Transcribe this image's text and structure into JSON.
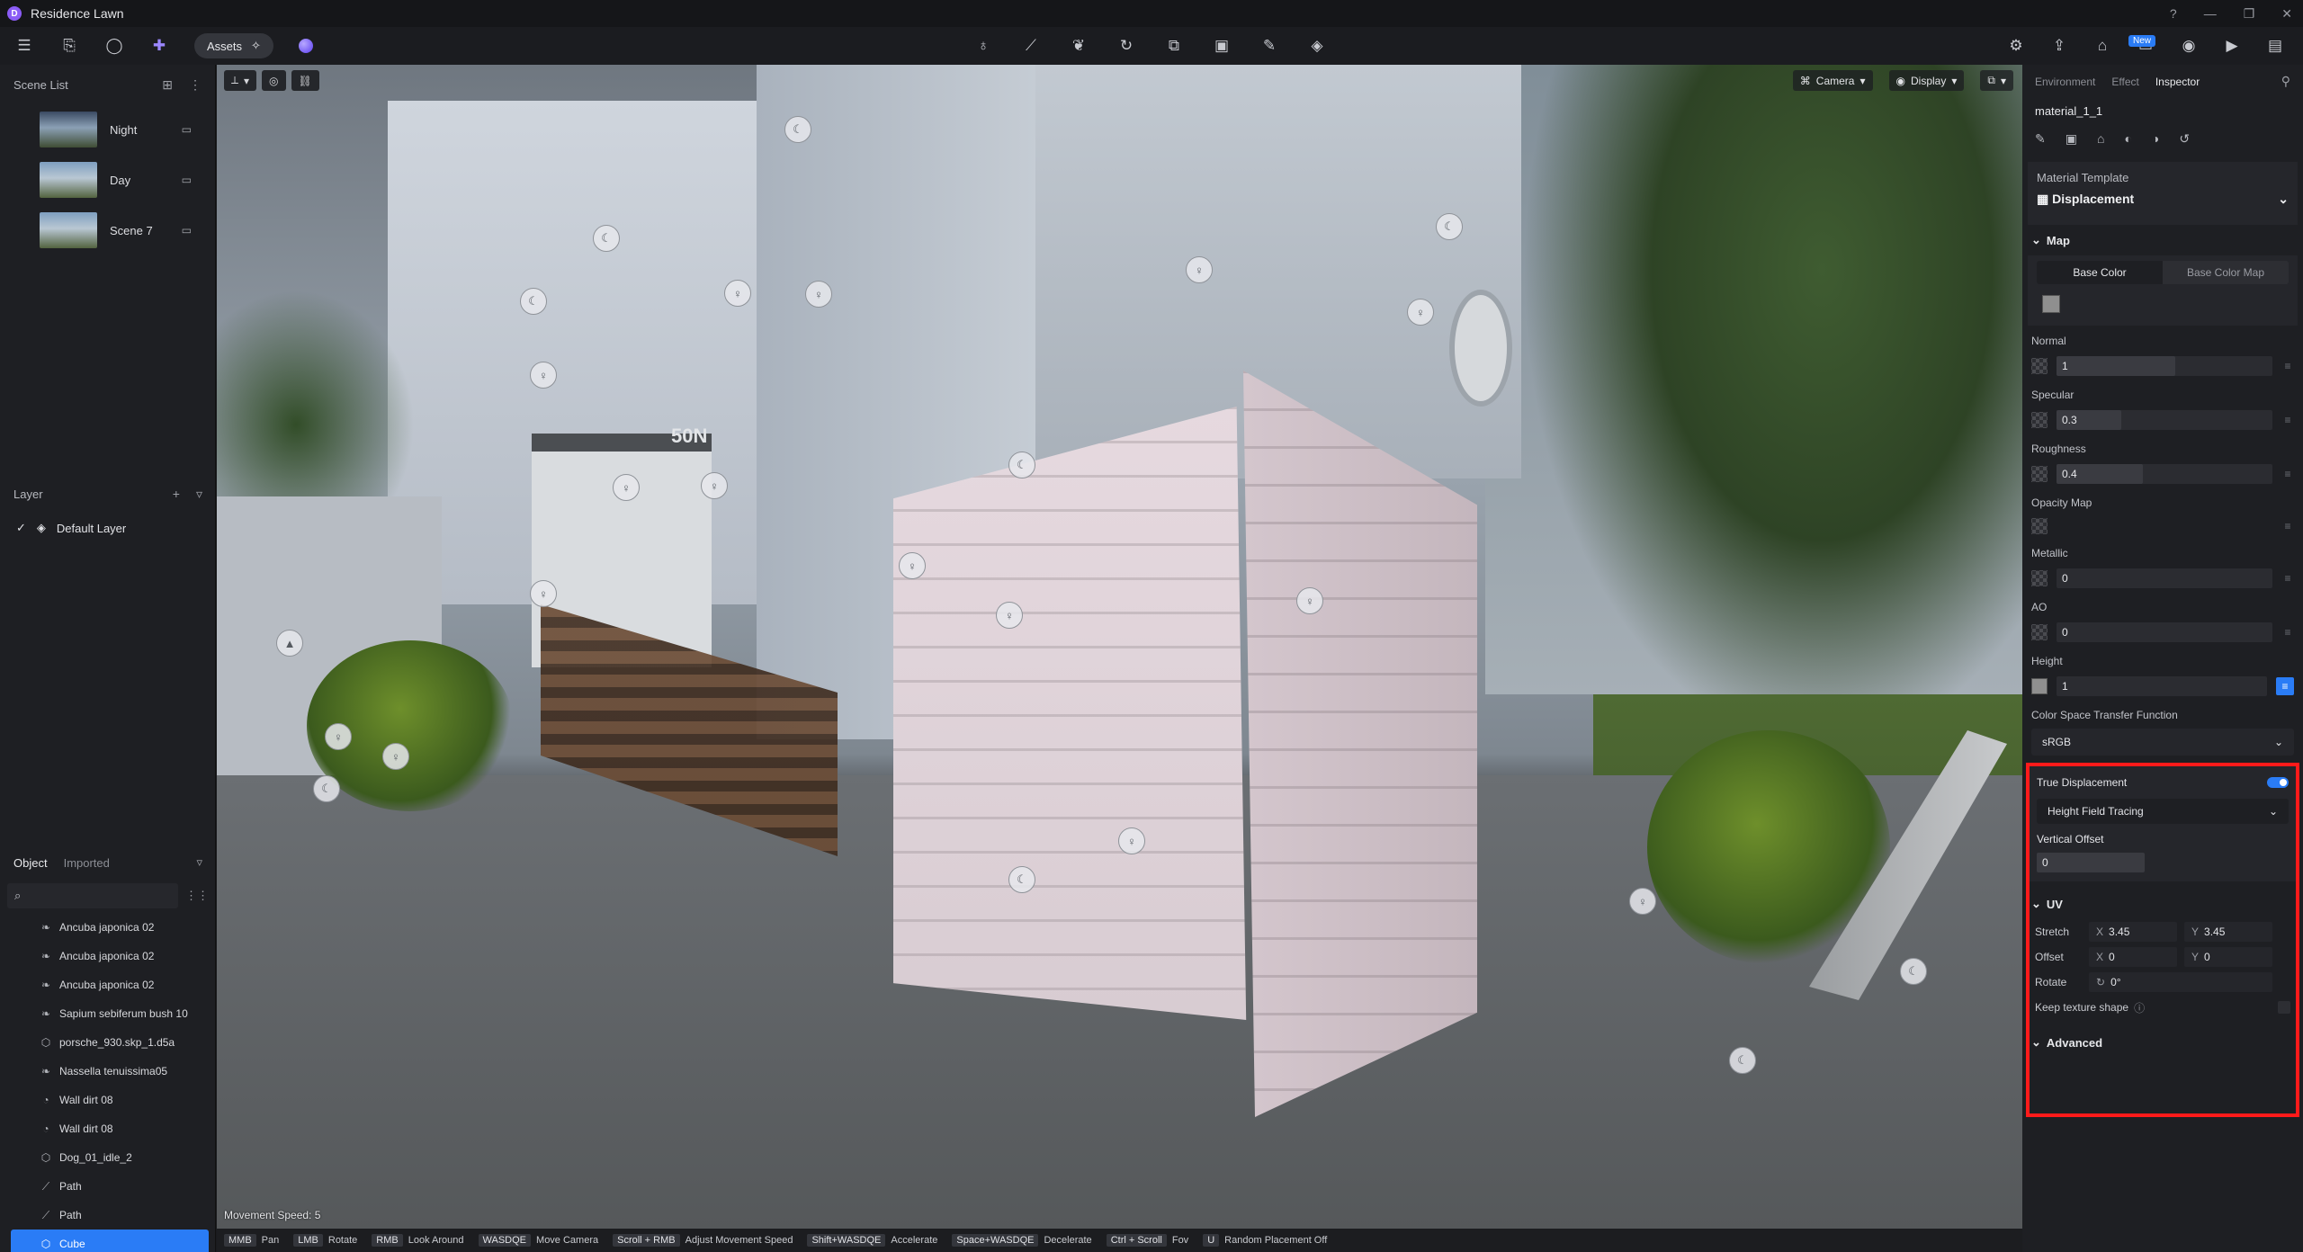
{
  "app": {
    "title": "Residence Lawn",
    "logo_letter": "D"
  },
  "window_controls": [
    "?",
    "—",
    "❐",
    "✕"
  ],
  "toolbar": {
    "assets_label": "Assets",
    "new_badge": "New"
  },
  "scene_list": {
    "title": "Scene List",
    "items": [
      {
        "name": "Night"
      },
      {
        "name": "Day"
      },
      {
        "name": "Scene 7"
      }
    ]
  },
  "layer": {
    "title": "Layer",
    "items": [
      {
        "name": "Default Layer"
      }
    ]
  },
  "objects": {
    "tab_object": "Object",
    "tab_imported": "Imported",
    "items": [
      {
        "name": "Ancuba japonica 02",
        "icon": "leaf-icon"
      },
      {
        "name": "Ancuba japonica 02",
        "icon": "leaf-icon"
      },
      {
        "name": "Ancuba japonica 02",
        "icon": "leaf-icon"
      },
      {
        "name": "Sapium sebiferum bush 10",
        "icon": "leaf-icon"
      },
      {
        "name": "porsche_930.skp_1.d5a",
        "icon": "model-icon"
      },
      {
        "name": "Nassella tenuissima05",
        "icon": "leaf-icon"
      },
      {
        "name": "Wall dirt 08",
        "icon": "decal-icon"
      },
      {
        "name": "Wall dirt 08",
        "icon": "decal-icon"
      },
      {
        "name": "Dog_01_idle_2",
        "icon": "model-icon"
      },
      {
        "name": "Path",
        "icon": "path-icon"
      },
      {
        "name": "Path",
        "icon": "path-icon"
      },
      {
        "name": "Cube",
        "icon": "model-icon",
        "selected": true
      }
    ]
  },
  "viewport": {
    "sign_text": "50N",
    "camera_label": "Camera",
    "display_label": "Display",
    "movement_speed": "Movement Speed: 5",
    "hints": [
      {
        "key": "MMB",
        "action": "Pan"
      },
      {
        "key": "LMB",
        "action": "Rotate"
      },
      {
        "key": "RMB",
        "action": "Look Around"
      },
      {
        "key": "WASDQE",
        "action": "Move Camera"
      },
      {
        "key": "Scroll + RMB",
        "action": "Adjust Movement Speed"
      },
      {
        "key": "Shift+WASDQE",
        "action": "Accelerate"
      },
      {
        "key": "Space+WASDQE",
        "action": "Decelerate"
      },
      {
        "key": "Ctrl + Scroll",
        "action": "Fov"
      },
      {
        "key": "U",
        "action": "Random Placement Off"
      }
    ]
  },
  "inspector": {
    "tabs": [
      "Environment",
      "Effect",
      "Inspector"
    ],
    "active_tab": "Inspector",
    "material_name": "material_1_1",
    "template_label": "Material Template",
    "template_value": "Displacement",
    "map_title": "Map",
    "map_tabs": [
      "Base Color",
      "Base Color Map"
    ],
    "props": [
      {
        "label": "Normal",
        "value": "1",
        "fill_fraction": 0.55
      },
      {
        "label": "Specular",
        "value": "0.3",
        "fill_fraction": 0.3
      },
      {
        "label": "Roughness",
        "value": "0.4",
        "fill_fraction": 0.4
      },
      {
        "label": "Opacity Map",
        "value": ""
      },
      {
        "label": "Metallic",
        "value": "0",
        "fill_fraction": 0
      },
      {
        "label": "AO",
        "value": "0",
        "fill_fraction": 0
      }
    ],
    "height": {
      "label": "Height",
      "value": "1",
      "color_space_label": "Color Space Transfer Function",
      "color_space_value": "sRGB",
      "true_displacement_label": "True Displacement",
      "true_displacement_on": true,
      "method_value": "Height Field Tracing",
      "vertical_offset_label": "Vertical Offset",
      "vertical_offset_value": "0"
    },
    "uv": {
      "title": "UV",
      "stretch_label": "Stretch",
      "stretch_x": "3.45",
      "stretch_y": "3.45",
      "offset_label": "Offset",
      "offset_x": "0",
      "offset_y": "0",
      "rotate_label": "Rotate",
      "rotate_value": "0°",
      "keep_shape_label": "Keep texture shape"
    },
    "advanced_title": "Advanced"
  }
}
